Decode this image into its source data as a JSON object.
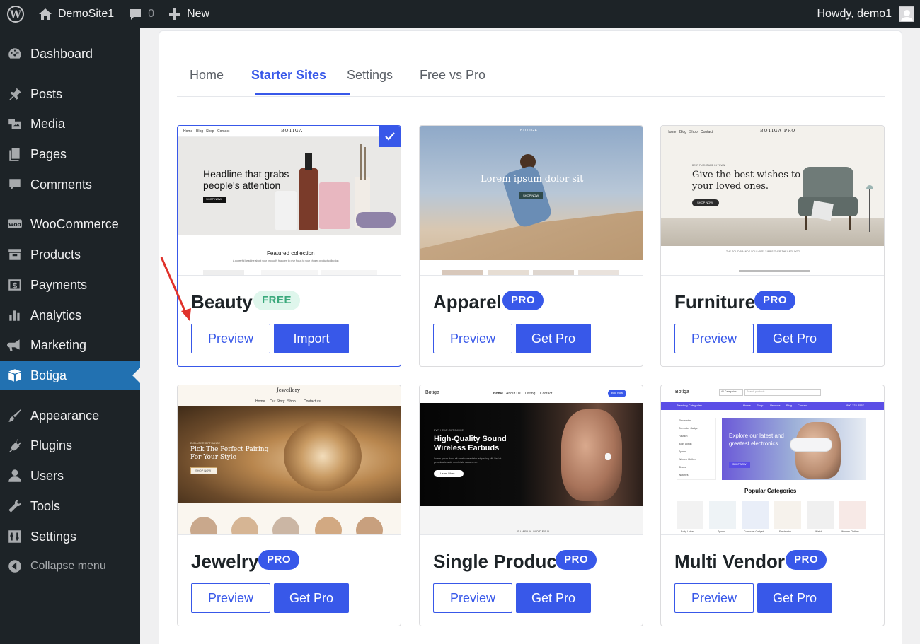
{
  "adminbar": {
    "site_name": "DemoSite1",
    "comments_count": "0",
    "new_label": "New",
    "greeting": "Howdy, demo1"
  },
  "sidebar": {
    "items": [
      {
        "label": "Dashboard",
        "icon": "dashboard-icon"
      },
      {
        "label": "Posts",
        "icon": "pin-icon"
      },
      {
        "label": "Media",
        "icon": "media-icon"
      },
      {
        "label": "Pages",
        "icon": "pages-icon"
      },
      {
        "label": "Comments",
        "icon": "comment-icon"
      },
      {
        "label": "WooCommerce",
        "icon": "woo-icon"
      },
      {
        "label": "Products",
        "icon": "archive-icon"
      },
      {
        "label": "Payments",
        "icon": "dollar-icon"
      },
      {
        "label": "Analytics",
        "icon": "bar-chart-icon"
      },
      {
        "label": "Marketing",
        "icon": "megaphone-icon"
      },
      {
        "label": "Botiga",
        "icon": "botiga-icon"
      },
      {
        "label": "Appearance",
        "icon": "brush-icon"
      },
      {
        "label": "Plugins",
        "icon": "plug-icon"
      },
      {
        "label": "Users",
        "icon": "user-icon"
      },
      {
        "label": "Tools",
        "icon": "wrench-icon"
      },
      {
        "label": "Settings",
        "icon": "sliders-icon"
      },
      {
        "label": "Collapse menu",
        "icon": "collapse-icon"
      }
    ],
    "active": "Botiga"
  },
  "tabs": [
    {
      "label": "Home"
    },
    {
      "label": "Starter Sites"
    },
    {
      "label": "Settings"
    },
    {
      "label": "Free vs Pro"
    }
  ],
  "active_tab": "Starter Sites",
  "cards": [
    {
      "title": "Beauty",
      "badge": "FREE",
      "preview": "Preview",
      "action": "Import",
      "selected": true,
      "thumb": {
        "brand": "BOTIGA",
        "nav": [
          "Home",
          "Blog",
          "Shop",
          "Contact"
        ],
        "headline": "Headline that grabs people's attention",
        "cta": "SHOP NOW",
        "section": "Featured collection",
        "section_sub": "A powerful headline about your product's features to give focus to your chosen product collection"
      }
    },
    {
      "title": "Apparel",
      "badge": "PRO",
      "preview": "Preview",
      "action": "Get Pro",
      "thumb": {
        "brand": "BOTIGA",
        "headline": "Lorem ipsum dolor sit",
        "cta": "SHOP NOW"
      }
    },
    {
      "title": "Furniture",
      "badge": "PRO",
      "preview": "Preview",
      "action": "Get Pro",
      "thumb": {
        "brand": "BOTIGA PRO",
        "nav": [
          "Home",
          "Blog",
          "Shop",
          "Contact"
        ],
        "kicker": "BEST FURNITURE IN TOWN",
        "headline": "Give the best wishes to your loved ones.",
        "cta": "SHOP NOW",
        "footnote": "THE SOLID BRANDS YOU LOVE, JUMPS OVER THE LAZY DOG"
      }
    },
    {
      "title": "Jewelry",
      "badge": "PRO",
      "preview": "Preview",
      "action": "Get Pro",
      "thumb": {
        "brand": "Jewellery",
        "nav": [
          "Home",
          "Our Story",
          "Shop",
          "Contact us"
        ],
        "kicker": "EXCLUSIVE GIFT RANGE",
        "headline": "Pick The Perfect Pairing For Your Style",
        "cta": "SHOP NOW"
      }
    },
    {
      "title": "Single Product",
      "badge": "PRO",
      "preview": "Preview",
      "action": "Get Pro",
      "thumb": {
        "brand": "Botiga",
        "nav": [
          "Home",
          "About Us",
          "Listing",
          "Contact"
        ],
        "button": "Buy Now",
        "kicker": "EXCLUSIVE GIFT RANGE",
        "headline": "High-Quality Sound Wireless Earbuds",
        "body": "Lorem ipsum dolor sit amet consectetur adipiscing elit. Sed ut perspiciatis unde omnis iste natus error.",
        "cta": "Learn More",
        "footer": "SIMPLY MODERN"
      }
    },
    {
      "title": "Multi Vendor",
      "badge": "PRO",
      "preview": "Preview",
      "action": "Get Pro",
      "thumb": {
        "brand": "Botiga",
        "select": "All Categories",
        "search": "Search products...",
        "phone": "800-123-4567",
        "nav_label": "Trending Categories",
        "nav": [
          "Home",
          "Shop",
          "Vendors",
          "Blog",
          "Contact"
        ],
        "categories": [
          "Electronics",
          "Computer Gadget",
          "Fashion",
          "Body Lotion",
          "Sports",
          "Women Clothes",
          "Shoes",
          "Watches"
        ],
        "headline": "Explore our latest and greatest electronics",
        "cta": "SHOP NOW",
        "section": "Popular Categories",
        "products": [
          "Body Lotion",
          "Sports",
          "Computer Gadget",
          "Electronics",
          "Watch",
          "Women Clothes"
        ]
      }
    }
  ],
  "colors": {
    "accent": "#3858e9",
    "sidebar_bg": "#1d2327",
    "sidebar_active": "#2271b1",
    "free_badge_bg": "#dff6ec",
    "free_badge_text": "#3ba97c"
  }
}
